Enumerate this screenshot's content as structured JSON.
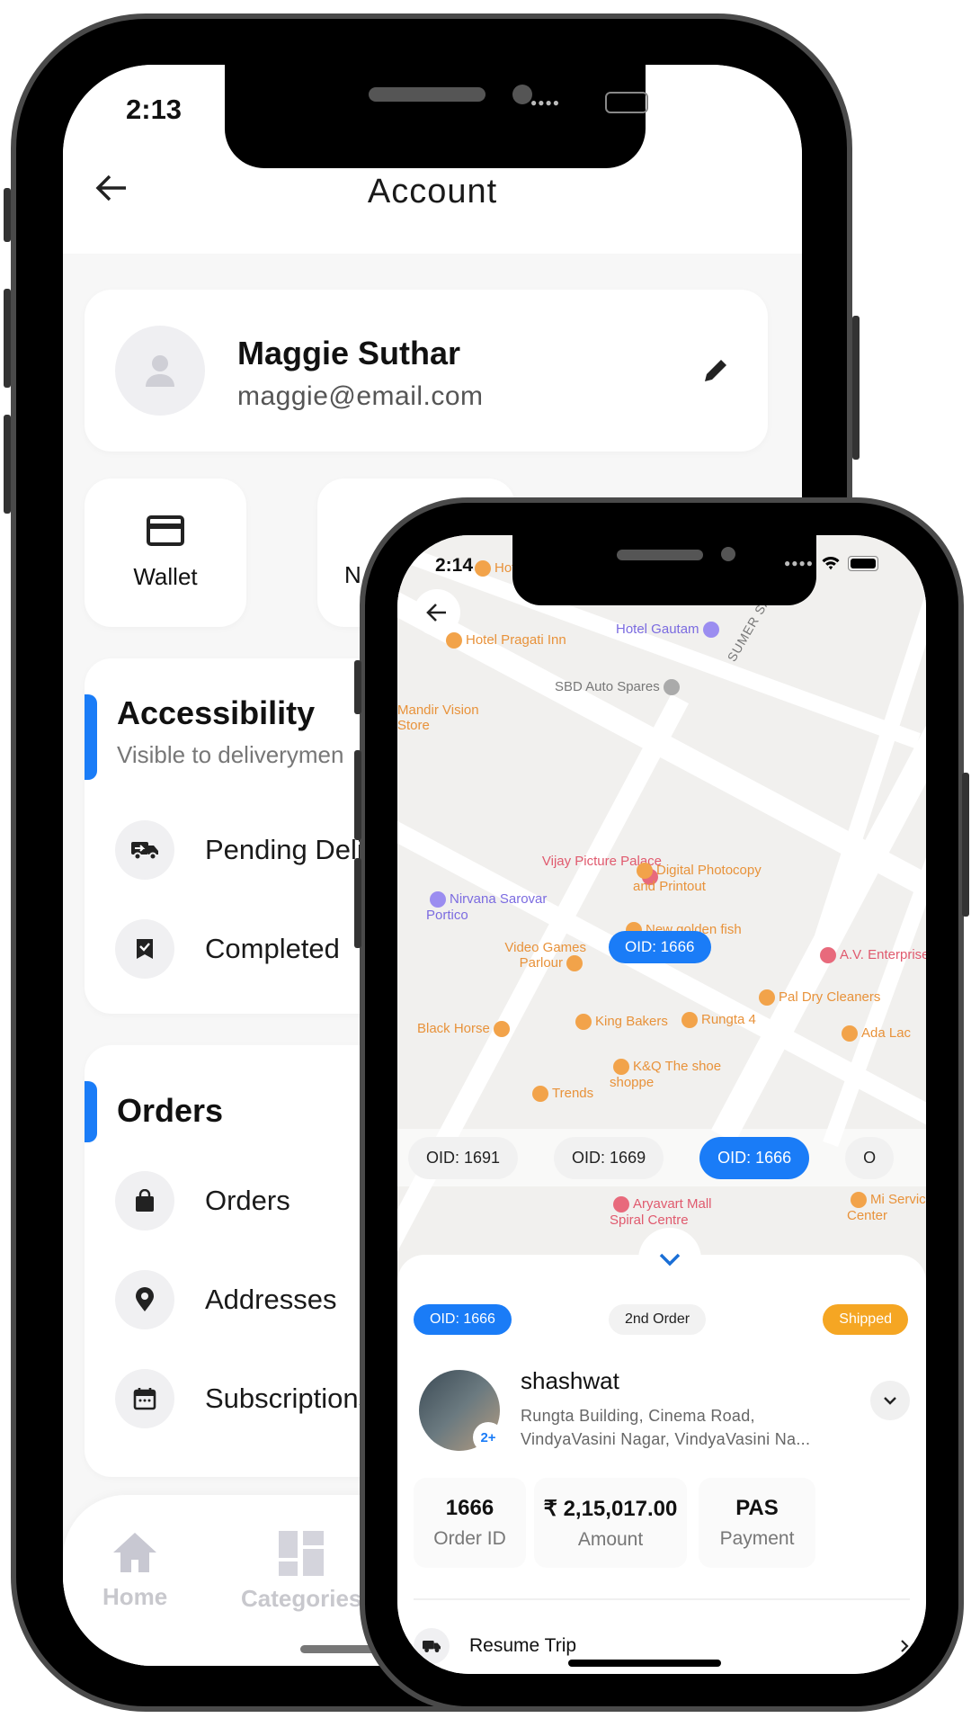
{
  "phone1": {
    "status": {
      "time": "2:13"
    },
    "header": {
      "title": "Account"
    },
    "profile": {
      "name": "Maggie Suthar",
      "email": "maggie@email.com"
    },
    "tiles": [
      {
        "label": "Wallet",
        "icon": "credit-card-icon"
      },
      {
        "label": "N",
        "icon": "unknown"
      }
    ],
    "accessibility": {
      "title": "Accessibility",
      "subtitle": "Visible to deliverymen",
      "items": [
        {
          "label": "Pending Deliveries",
          "icon": "truck-icon"
        },
        {
          "label": "Completed",
          "icon": "bookmark-check-icon"
        }
      ]
    },
    "orders": {
      "title": "Orders",
      "items": [
        {
          "label": "Orders",
          "icon": "shopping-bag-icon"
        },
        {
          "label": "Addresses",
          "icon": "location-pin-icon"
        },
        {
          "label": "Subscriptions",
          "icon": "calendar-icon"
        }
      ]
    },
    "nav": [
      {
        "label": "Home",
        "icon": "home-icon"
      },
      {
        "label": "Categories",
        "icon": "dashboard-icon"
      }
    ]
  },
  "phone2": {
    "status": {
      "time": "2:14"
    },
    "map": {
      "pois": [
        {
          "label": "Hotel Palace",
          "type": "orange"
        },
        {
          "label": "Hotel Pragati Inn",
          "type": "orange"
        },
        {
          "label": "Hotel Gautam",
          "type": "purple"
        },
        {
          "label": "SBD Auto Spares",
          "type": "gray"
        },
        {
          "label": "Mandir Vision Store",
          "type": "orange"
        },
        {
          "label": "SUMER SAGAR ROAD",
          "type": "road"
        },
        {
          "label": "Vijay Picture Palace",
          "type": "pink"
        },
        {
          "label": "Digital Photocopy and Printout",
          "type": "orange"
        },
        {
          "label": "Nirvana Sarovar Portico",
          "type": "purple"
        },
        {
          "label": "New golden fish aquarium",
          "type": "orange"
        },
        {
          "label": "Video Games Parlour",
          "type": "orange"
        },
        {
          "label": "A.V. Enterprises",
          "type": "pink"
        },
        {
          "label": "Pal Dry Cleaners",
          "type": "orange"
        },
        {
          "label": "King Bakers",
          "type": "orange"
        },
        {
          "label": "Rungta 4",
          "type": "orange"
        },
        {
          "label": "Black Horse",
          "type": "orange"
        },
        {
          "label": "Ada Lac",
          "type": "orange"
        },
        {
          "label": "K&Q The shoe shoppe",
          "type": "orange"
        },
        {
          "label": "Trends",
          "type": "orange"
        },
        {
          "label": "Aryavart Mall Spiral Centre",
          "type": "pink"
        },
        {
          "label": "Mi Service Center",
          "type": "orange"
        }
      ],
      "marker": "OID: 1666"
    },
    "chips": [
      {
        "label": "OID: 1691",
        "active": false
      },
      {
        "label": "OID: 1669",
        "active": false
      },
      {
        "label": "OID: 1666",
        "active": true
      },
      {
        "label": "O",
        "active": false
      }
    ],
    "sheet": {
      "oid_badge": "OID: 1666",
      "order_badge": "2nd Order",
      "status_badge": "Shipped",
      "customer": {
        "name": "shashwat",
        "address_line1": "Rungta Building,  Cinema Road,",
        "address_line2": "VindyaVasini Nagar, VindyaVasini Na...",
        "extra_count": "2+"
      },
      "stats": [
        {
          "value": "1666",
          "label": "Order ID"
        },
        {
          "value": "₹ 2,15,017.00",
          "label": "Amount"
        },
        {
          "value": "PAS",
          "label": "Payment"
        }
      ],
      "action": {
        "label": "Resume Trip",
        "icon": "truck-icon"
      }
    },
    "colors": {
      "accent": "#1A7CF7",
      "shipped": "#F5A623"
    }
  }
}
